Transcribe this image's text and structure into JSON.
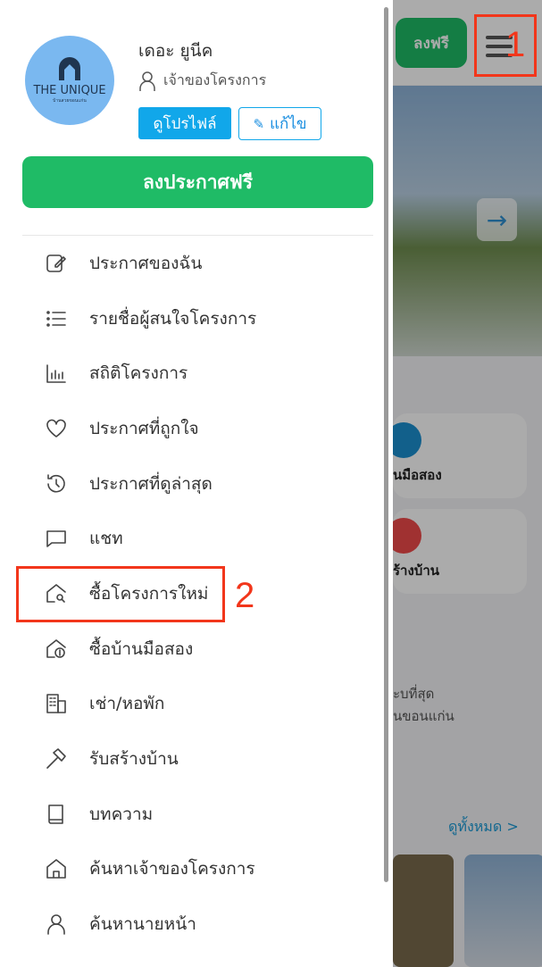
{
  "background": {
    "post_free_label": "ลงฟรี",
    "card1_label": "นมือสอง",
    "card2_label": "ร้างบ้าน",
    "desc_line1": "ะบที่สุด",
    "desc_line2": "นขอนแก่น",
    "see_all_label": "ดูทั้งหมด >",
    "arrow_icon": "arrow-right-icon"
  },
  "annotations": {
    "menu_button_number": "1",
    "menu_item_number": "2",
    "color": "#f2361b"
  },
  "profile": {
    "logo_text": "THE UNIQUE",
    "logo_subtext": "บ้านสวยขอนแก่น",
    "name": "เดอะ ยูนีค",
    "role": "เจ้าของโครงการ",
    "view_profile_label": "ดูโปรไฟล์",
    "edit_label": "แก้ไข"
  },
  "post_button_label": "ลงประกาศฟรี",
  "colors": {
    "green": "#1fbb66",
    "blue": "#11a7ea"
  },
  "menu": [
    {
      "label": "ประกาศของฉัน",
      "icon": "edit-note-icon"
    },
    {
      "label": "รายชื่อผู้สนใจโครงการ",
      "icon": "list-icon"
    },
    {
      "label": "สถิติโครงการ",
      "icon": "bar-chart-icon"
    },
    {
      "label": "ประกาศที่ถูกใจ",
      "icon": "heart-icon"
    },
    {
      "label": "ประกาศที่ดูล่าสุด",
      "icon": "history-icon"
    },
    {
      "label": "แชท",
      "icon": "chat-icon"
    },
    {
      "label": "ซื้อโครงการใหม่",
      "icon": "house-search-icon"
    },
    {
      "label": "ซื้อบ้านมือสอง",
      "icon": "house-dollar-icon"
    },
    {
      "label": "เช่า/หอพัก",
      "icon": "building-icon"
    },
    {
      "label": "รับสร้างบ้าน",
      "icon": "hammer-icon"
    },
    {
      "label": "บทความ",
      "icon": "book-icon"
    },
    {
      "label": "ค้นหาเจ้าของโครงการ",
      "icon": "house-icon"
    },
    {
      "label": "ค้นหานายหน้า",
      "icon": "person-icon"
    }
  ]
}
